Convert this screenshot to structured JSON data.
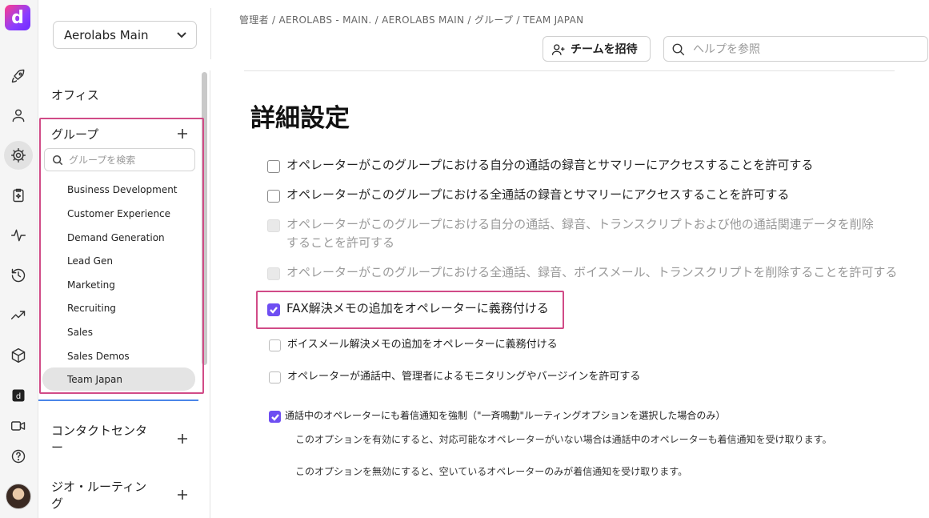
{
  "workspace": {
    "name": "Aerolabs Main"
  },
  "breadcrumb": "管理者 / AEROLABS - MAIN. / AEROLABS MAIN / グループ / TEAM JAPAN",
  "topbar": {
    "invite_label": "チームを招待",
    "help_placeholder": "ヘルプを参照"
  },
  "sidebar": {
    "office": "オフィス",
    "groups_title": "グループ",
    "group_search_placeholder": "グループを検索",
    "groups": [
      "Business Development",
      "Customer Experience",
      "Demand Generation",
      "Lead Gen",
      "Marketing",
      "Recruiting",
      "Sales",
      "Sales Demos",
      "Team Japan"
    ],
    "selected_group": "Team Japan",
    "contact_center": "コンタクトセンター",
    "geo_routing": "ジオ・ルーティング"
  },
  "main": {
    "title": "詳細設定",
    "options": [
      {
        "label": "オペレーターがこのグループにおける自分の通話の録音とサマリーにアクセスすることを許可する",
        "checked": false,
        "disabled": false
      },
      {
        "label": "オペレーターがこのグループにおける全通話の録音とサマリーにアクセスすることを許可する",
        "checked": false,
        "disabled": false
      },
      {
        "label": "オペレーターがこのグループにおける自分の通話、録音、トランスクリプトおよび他の通話関連データを削除することを許可する",
        "checked": false,
        "disabled": true
      },
      {
        "label": "オペレーターがこのグループにおける全通話、録音、ボイスメール、トランスクリプトを削除することを許可する",
        "checked": false,
        "disabled": true
      },
      {
        "label": "FAX解決メモの追加をオペレーターに義務付ける",
        "checked": true,
        "disabled": false
      },
      {
        "label": "ボイスメール解決メモの追加をオペレーターに義務付ける",
        "checked": false,
        "disabled": false
      },
      {
        "label": "オペレーターが通話中、管理者によるモニタリングやバージインを許可する",
        "checked": false,
        "disabled": false
      },
      {
        "label": "通話中のオペレーターにも着信通知を強制（\"一斉鳴動\"ルーティングオプションを選択した場合のみ）",
        "checked": true,
        "disabled": false
      }
    ],
    "desc_enabled": "このオプションを有効にすると、対応可能なオペレーターがいない場合は通話中のオペレーターも着信通知を受け取ります。",
    "desc_disabled": "このオプションを無効にすると、空いているオペレーターのみが着信通知を受け取ります。"
  },
  "colors": {
    "accent": "#6e4ef2",
    "highlight": "#d14b87"
  }
}
